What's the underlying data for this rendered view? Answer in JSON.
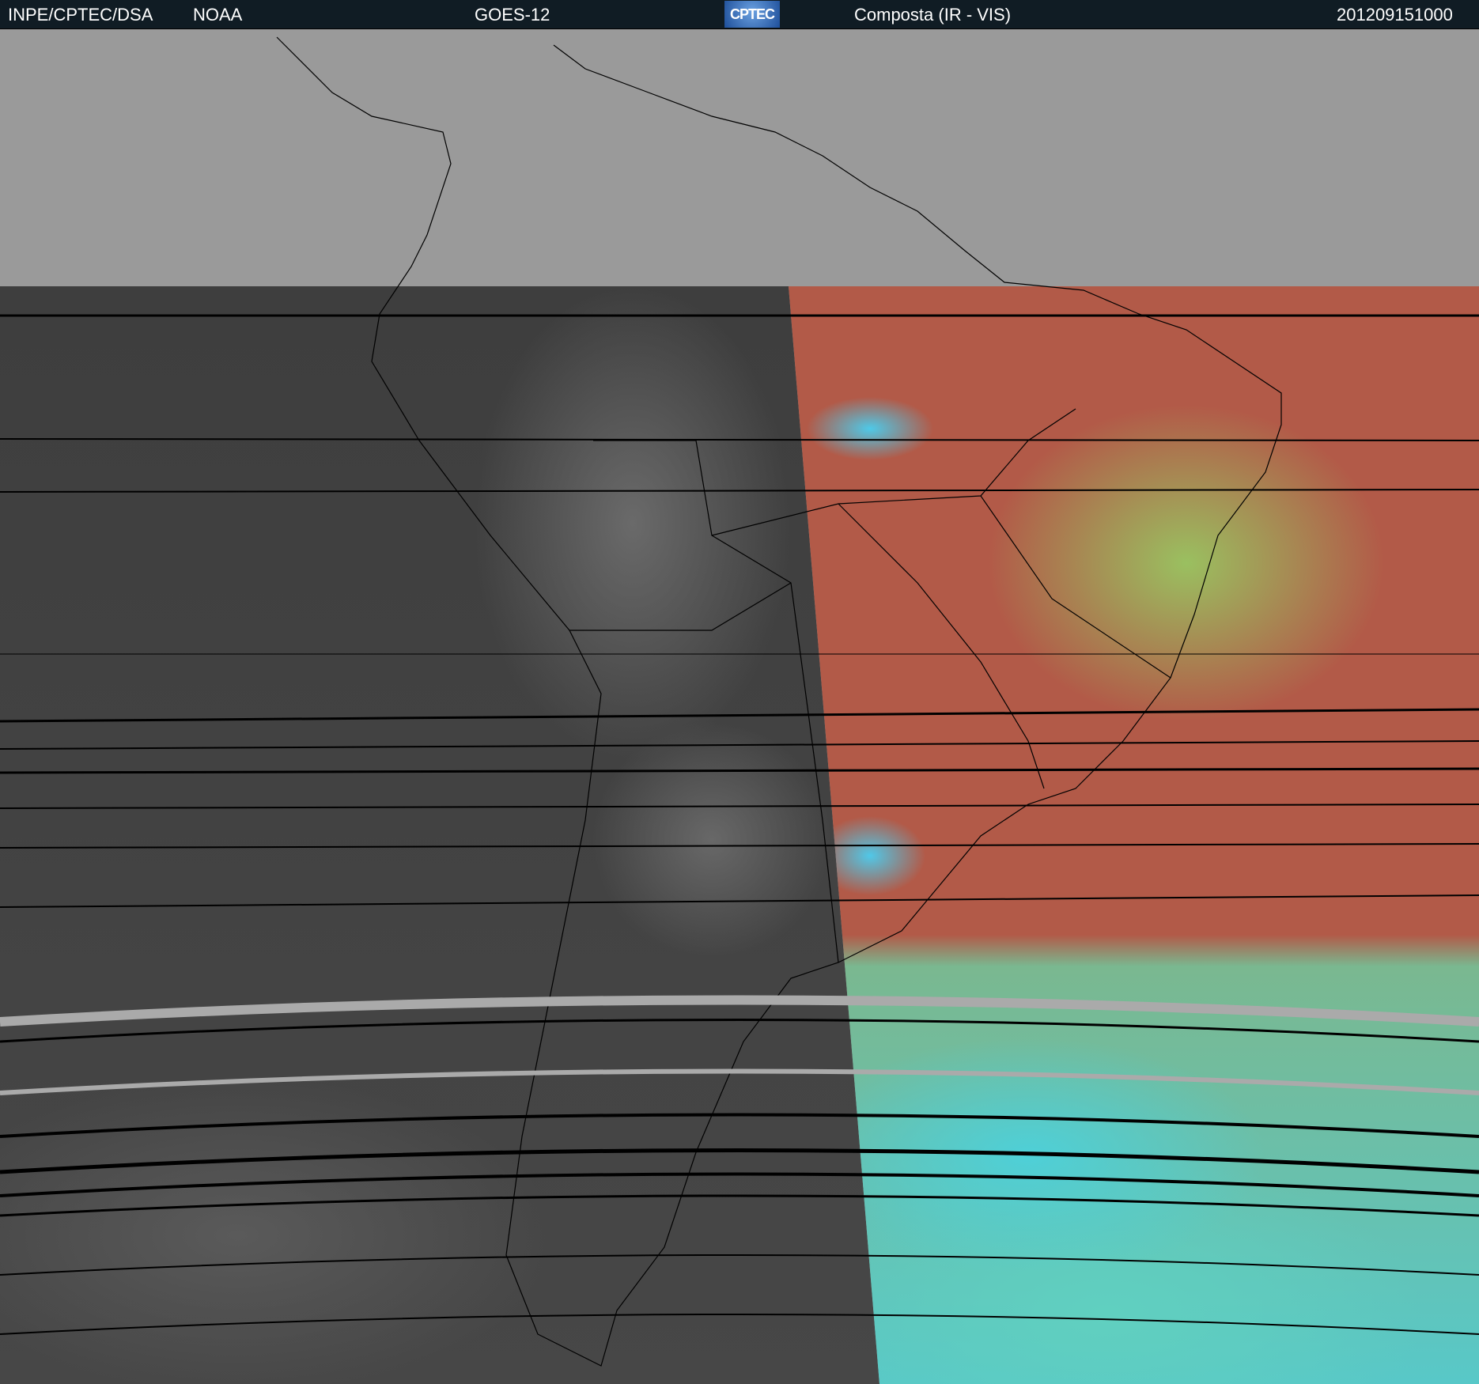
{
  "header": {
    "institution": "INPE/CPTEC/DSA",
    "agency": "NOAA",
    "satellite": "GOES-12",
    "logo_text": "CPTEC",
    "product": "Composta (IR - VIS)",
    "timestamp": "201209151000"
  },
  "colors": {
    "header_bg": "#101c24",
    "no_data": "#9a9a9a",
    "ir": "#444444",
    "composite": "#b25a48"
  }
}
